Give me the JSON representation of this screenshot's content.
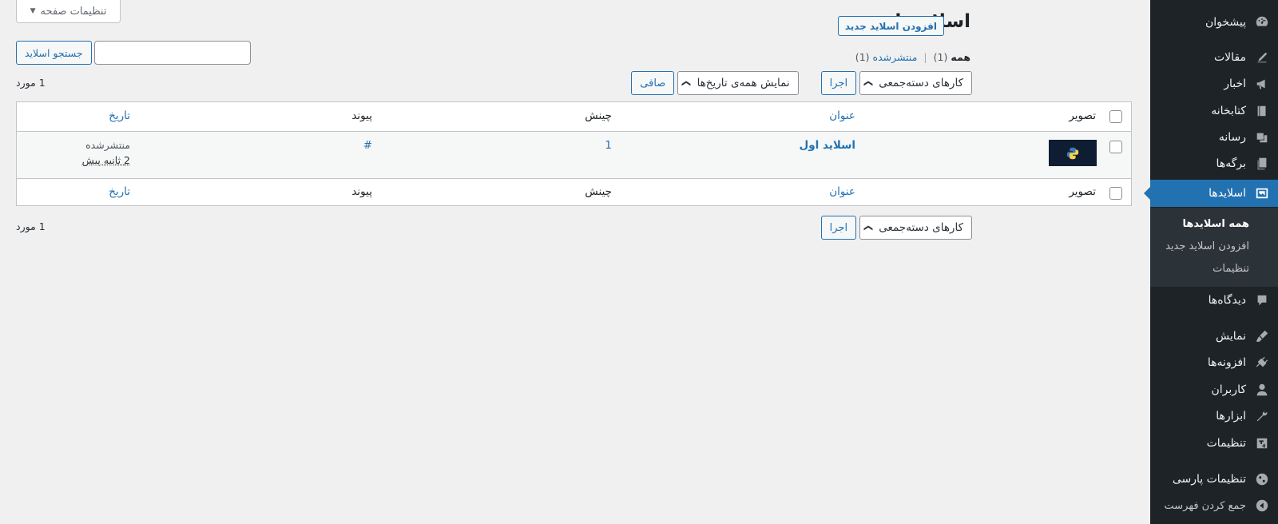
{
  "sidebar": {
    "items": [
      {
        "label": "پیشخوان",
        "icon": "dashboard-icon"
      },
      {
        "label": "مقالات",
        "icon": "pin-icon"
      },
      {
        "label": "اخبار",
        "icon": "megaphone-icon"
      },
      {
        "label": "کتابخانه",
        "icon": "book-icon"
      },
      {
        "label": "رسانه",
        "icon": "media-icon"
      },
      {
        "label": "برگه‌ها",
        "icon": "pages-icon"
      },
      {
        "label": "اسلایدها",
        "icon": "slides-icon"
      },
      {
        "label": "دیدگاه‌ها",
        "icon": "comment-icon"
      },
      {
        "label": "نمایش",
        "icon": "brush-icon"
      },
      {
        "label": "افزونه‌ها",
        "icon": "plugin-icon"
      },
      {
        "label": "کاربران",
        "icon": "user-icon"
      },
      {
        "label": "ابزارها",
        "icon": "wrench-icon"
      },
      {
        "label": "تنظیمات",
        "icon": "settings-icon"
      },
      {
        "label": "تنظیمات پارسی",
        "icon": "globe-icon"
      },
      {
        "label": "جمع کردن فهرست",
        "icon": "collapse-icon"
      }
    ],
    "submenu": [
      "همه اسلایدها",
      "افزودن اسلاید جدید",
      "تنظیمات"
    ]
  },
  "header": {
    "screen_options": "تنظیمات صفحه",
    "title": "اسلایدها",
    "add_new": "افزودن اسلاید جدید"
  },
  "filters": {
    "all_label": "همه",
    "all_count": "(1)",
    "separator": "|",
    "published_label": "منتشرشده",
    "published_count": "(1)"
  },
  "search": {
    "button": "جستجو اسلاید",
    "value": ""
  },
  "tablenav": {
    "bulk_actions": "کارهای دسته‌جمعی",
    "apply": "اجرا",
    "dates": "نمایش همه‌ی تاریخ‌ها",
    "filter": "صافی",
    "items_count": "1 مورد"
  },
  "table": {
    "columns": {
      "image": "تصویر",
      "title": "عنوان",
      "order": "چینش",
      "link": "پیوند",
      "date": "تاریخ"
    },
    "rows": [
      {
        "title": "اسلاید اول",
        "order": "1",
        "link": "#",
        "status": "منتشرشده",
        "ago": "2 ثانیه پیش"
      }
    ]
  },
  "colors": {
    "accent": "#2271b1",
    "sidebar_bg": "#1d2327",
    "page_bg": "#f0f0f1"
  }
}
